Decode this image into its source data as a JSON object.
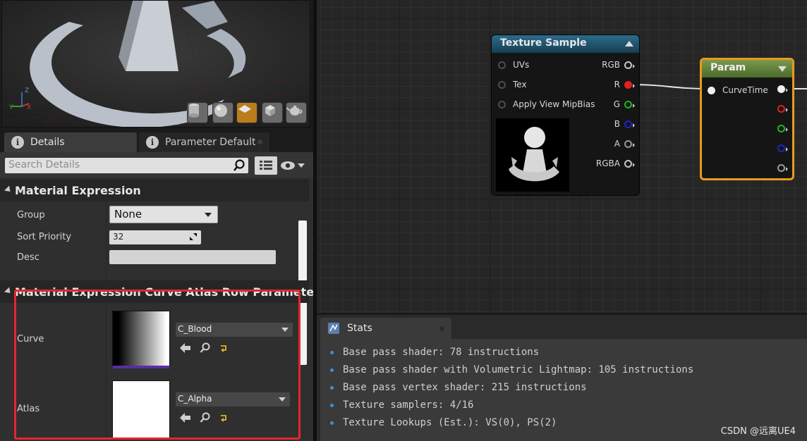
{
  "tabs": {
    "details": "Details",
    "parameter_defaults": "Parameter Defaults"
  },
  "details": {
    "search_placeholder": "Search Details",
    "section1_title": "Material Expression",
    "group_label": "Group",
    "group_value": "None",
    "sort_priority_label": "Sort Priority",
    "sort_priority_value": "32",
    "desc_label": "Desc",
    "section2_title": "Material Expression Curve Atlas Row Parameter",
    "curve_label": "Curve",
    "curve_value": "C_Blood",
    "atlas_label": "Atlas",
    "atlas_value": "C_Alpha"
  },
  "texture_node": {
    "title": "Texture Sample",
    "inputs": [
      "UVs",
      "Tex",
      "Apply View MipBias"
    ],
    "outputs": [
      "RGB",
      "R",
      "G",
      "B",
      "A",
      "RGBA"
    ]
  },
  "param_node": {
    "title": "Param",
    "input": "CurveTime"
  },
  "stats": {
    "tab": "Stats",
    "lines": [
      "Base pass shader: 78 instructions",
      "Base pass shader with Volumetric Lightmap: 105 instructions",
      "Base pass vertex shader: 215 instructions",
      "Texture samplers: 4/16",
      "Texture Lookups (Est.): VS(0), PS(2)"
    ]
  },
  "watermark": "CSDN @远离UE4",
  "colors": {
    "pin_r": "#e02020",
    "pin_g": "#1fb81f",
    "pin_b": "#2121c8",
    "highlight_box": "#e5262e",
    "param_outline": "#e89a1d"
  }
}
